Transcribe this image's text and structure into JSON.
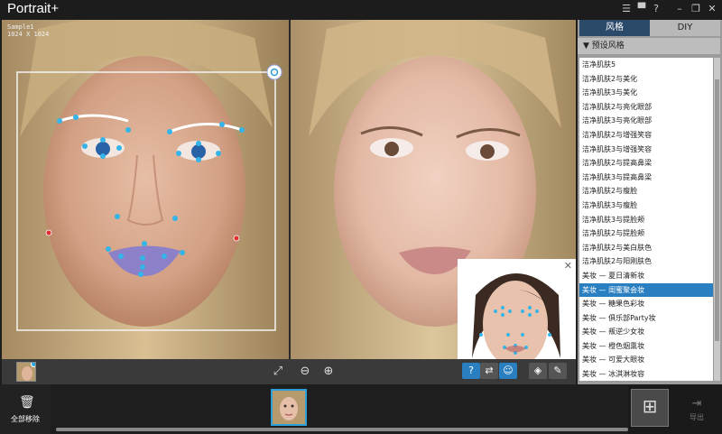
{
  "app": {
    "title": "Portrait+"
  },
  "window_controls": {
    "list_icon": "list-icon",
    "chat_icon": "chat-icon",
    "help": "?",
    "minimize": "–",
    "restore": "❐",
    "close": "✕"
  },
  "canvas": {
    "sample_name": "Sample1",
    "sample_size": "1024 X 1024"
  },
  "panel": {
    "tab_style": "风格",
    "tab_diy": "DIY",
    "section_title": "▼ 预设风格",
    "items": [
      {
        "label": "洁净肌肤5",
        "selected": false
      },
      {
        "label": "洁净肌肤2与美化",
        "selected": false
      },
      {
        "label": "洁净肌肤3与美化",
        "selected": false
      },
      {
        "label": "洁净肌肤2与亮化眼部",
        "selected": false
      },
      {
        "label": "洁净肌肤3与亮化眼部",
        "selected": false
      },
      {
        "label": "洁净肌肤2与增强笑容",
        "selected": false
      },
      {
        "label": "洁净肌肤3与增强笑容",
        "selected": false
      },
      {
        "label": "洁净肌肤2与提高鼻梁",
        "selected": false
      },
      {
        "label": "洁净肌肤3与提高鼻梁",
        "selected": false
      },
      {
        "label": "洁净肌肤2与瘦脸",
        "selected": false
      },
      {
        "label": "洁净肌肤3与瘦脸",
        "selected": false
      },
      {
        "label": "洁净肌肤3与提脸颊",
        "selected": false
      },
      {
        "label": "洁净肌肤2与提脸颊",
        "selected": false
      },
      {
        "label": "洁净肌肤2与美白肤色",
        "selected": false
      },
      {
        "label": "洁净肌肤2与阳刚肤色",
        "selected": false
      },
      {
        "label": "美妆 — 夏日清新妆",
        "selected": false
      },
      {
        "label": "美妆 — 闺蜜聚会妆",
        "selected": true
      },
      {
        "label": "美妆 — 糖果色彩妆",
        "selected": false
      },
      {
        "label": "美妆 — 俱乐部Party妆",
        "selected": false
      },
      {
        "label": "美妆 — 叛逆少女妆",
        "selected": false
      },
      {
        "label": "美妆 — 橙色烟熏妆",
        "selected": false
      },
      {
        "label": "美妆 — 可爱大眼妆",
        "selected": false
      },
      {
        "label": "美妆 — 冰淇淋妆容",
        "selected": false
      }
    ]
  },
  "toolbar": {
    "fit_icon": "fit-screen-icon",
    "zoom_out_icon": "zoom-out-icon",
    "zoom_in_icon": "zoom-in-icon",
    "help_label": "?",
    "compare_icon": "swap-icon",
    "smile_icon": "face-icon",
    "eraser_icon": "eraser-icon",
    "brush_icon": "brush-icon"
  },
  "bottom": {
    "remove_all_label": "全部移除",
    "export_label": "导出",
    "filmstrip_scroll_fraction": 1.0
  },
  "colors": {
    "accent": "#2a7fc0",
    "landmark": "#34b4e8",
    "landmark_error": "#e03030"
  }
}
